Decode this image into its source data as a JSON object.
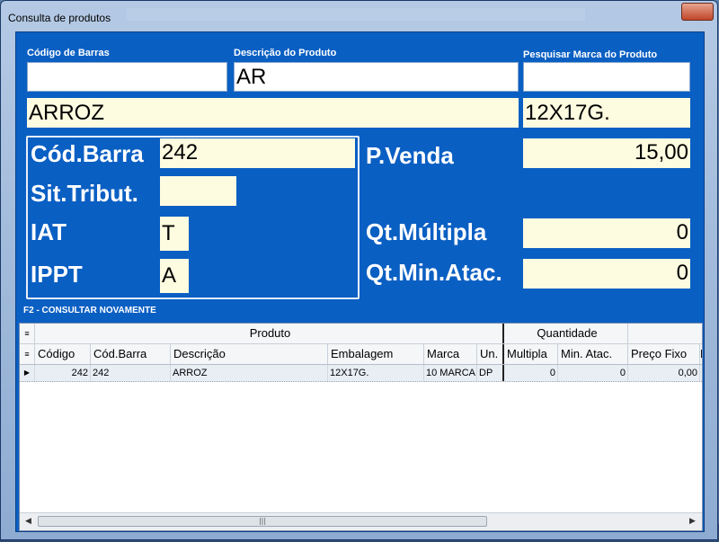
{
  "window": {
    "title": "Consulta de produtos"
  },
  "search": {
    "barcode_label": "Código de Barras",
    "barcode_value": "",
    "description_label": "Descrição do Produto",
    "description_value": "AR",
    "brand_label": "Pesquisar Marca do Produto",
    "brand_value": ""
  },
  "product": {
    "name": "ARROZ",
    "package": "12X17G.",
    "cod_barra_label": "Cód.Barra",
    "cod_barra_value": "242",
    "sit_tribut_label": "Sit.Tribut.",
    "sit_tribut_value": "",
    "iat_label": "IAT",
    "iat_value": "T",
    "ippt_label": "IPPT",
    "ippt_value": "A",
    "pvenda_label": "P.Venda",
    "pvenda_value": "15,00",
    "qt_multipla_label": "Qt.Múltipla",
    "qt_multipla_value": "0",
    "qt_min_atac_label": "Qt.Min.Atac.",
    "qt_min_atac_value": "0"
  },
  "hint": "F2 - CONSULTAR NOVAMENTE",
  "grid": {
    "group_headers": [
      "Produto",
      "Quantidade"
    ],
    "columns": [
      "Código",
      "Cód.Barra",
      "Descrição",
      "Embalagem",
      "Marca",
      "Un.",
      "Multipla",
      "Min. Atac.",
      "Preço Fixo",
      "P"
    ],
    "rows": [
      [
        "242",
        "242",
        "ARROZ",
        "12X17G.",
        "10 MARCA",
        "DP",
        "0",
        "0",
        "0,00",
        ""
      ]
    ],
    "scroll_thumb": "|||"
  },
  "colors": {
    "client_bg": "#0a5fc3",
    "field_cream": "#fdfbe0",
    "label_white": "#ffffff"
  },
  "icons": [
    "close-icon",
    "grid-menu-icon",
    "row-pointer-icon",
    "scroll-left-icon",
    "scroll-right-icon"
  ]
}
